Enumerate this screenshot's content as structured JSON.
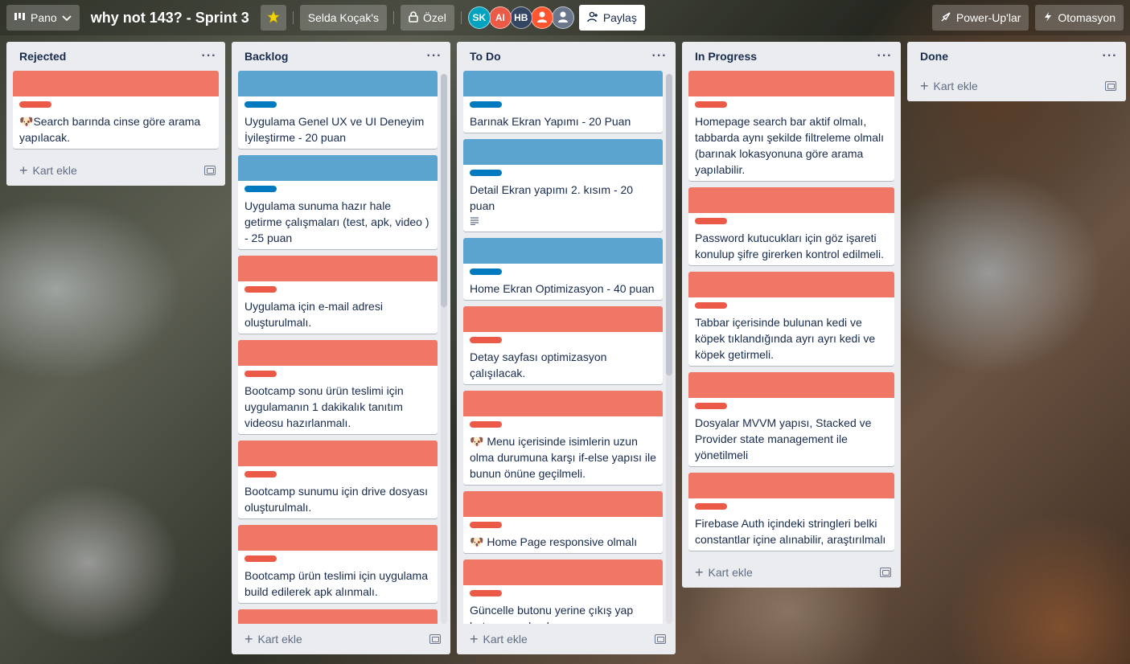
{
  "colors": {
    "red_label": "#eb5a46",
    "red_cover": "#f07766",
    "blue_label": "#0079bf",
    "blue_cover": "#5ba4cf"
  },
  "topbar": {
    "view_icon": "board-icon",
    "view_label": "Pano",
    "board_title": "why not 143? - Sprint 3",
    "workspace": "Selda Koçak's",
    "visibility": "Özel",
    "avatars": [
      {
        "initials": "SK",
        "color": "#00a3bf"
      },
      {
        "initials": "AI",
        "color": "#eb5a46"
      },
      {
        "initials": "HB",
        "color": "#344563"
      },
      {
        "initials": "",
        "color": "#ff5630"
      },
      {
        "initials": "",
        "color": "#6b778c"
      }
    ],
    "share_label": "Paylaş",
    "powerups_label": "Power-Up'lar",
    "automation_label": "Otomasyon"
  },
  "lists": [
    {
      "title": "Rejected",
      "add_card": "Kart ekle",
      "cards": [
        {
          "cover": "red",
          "label": "red",
          "emoji": "🐶",
          "title": "Search barında cinse göre arama yapılacak."
        }
      ]
    },
    {
      "title": "Backlog",
      "add_card": "Kart ekle",
      "cards": [
        {
          "cover": "blue",
          "label": "blue",
          "title": "Uygulama Genel UX ve UI Deneyim İyileştirme - 20 puan"
        },
        {
          "cover": "blue",
          "label": "blue",
          "title": "Uygulama sunuma hazır hale getirme çalışmaları (test, apk, video ) - 25 puan"
        },
        {
          "cover": "red",
          "label": "red",
          "title": "Uygulama için e-mail adresi oluşturulmalı."
        },
        {
          "cover": "red",
          "label": "red",
          "title": "Bootcamp sonu ürün teslimi için uygulamanın 1 dakikalık tanıtım videosu hazırlanmalı."
        },
        {
          "cover": "red",
          "label": "red",
          "title": "Bootcamp sunumu için drive dosyası oluşturulmalı."
        },
        {
          "cover": "red",
          "label": "red",
          "title": "Bootcamp ürün teslimi için uygulama build edilerek apk alınmalı."
        },
        {
          "cover": "red",
          "label": "red",
          "title": ""
        }
      ]
    },
    {
      "title": "To Do",
      "add_card": "Kart ekle",
      "cards": [
        {
          "cover": "blue",
          "label": "blue",
          "title": "Barınak Ekran Yapımı - 20 Puan"
        },
        {
          "cover": "blue",
          "label": "blue",
          "title": "Detail Ekran yapımı 2. kısım - 20 puan",
          "has_description": true
        },
        {
          "cover": "blue",
          "label": "blue",
          "title": "Home Ekran Optimizasyon - 40 puan"
        },
        {
          "cover": "red",
          "label": "red",
          "title": "Detay sayfası optimizasyon çalışılacak."
        },
        {
          "cover": "red",
          "label": "red",
          "emoji": "🐶",
          "title": " Menu içerisinde isimlerin uzun olma durumuna karşı if-else yapısı ile bunun önüne geçilmeli."
        },
        {
          "cover": "red",
          "label": "red",
          "emoji": "🐶",
          "title": " Home Page responsive olmalı"
        },
        {
          "cover": "red",
          "label": "red",
          "title": "Güncelle butonu yerine çıkış yap butonu yapılmalı"
        }
      ]
    },
    {
      "title": "In Progress",
      "add_card": "Kart ekle",
      "cards": [
        {
          "cover": "red",
          "label": "red",
          "title": "Homepage search bar aktif olmalı, tabbarda aynı şekilde filtreleme olmalı (barınak lokasyonuna göre arama yapılabilir."
        },
        {
          "cover": "red",
          "label": "red",
          "title": "Password kutucukları için göz işareti konulup şifre girerken kontrol edilmeli."
        },
        {
          "cover": "red",
          "label": "red",
          "title": "Tabbar içerisinde bulunan kedi ve köpek tıklandığında ayrı ayrı kedi ve köpek getirmeli."
        },
        {
          "cover": "red",
          "label": "red",
          "title": "Dosyalar MVVM yapısı, Stacked ve Provider state management ile yönetilmeli"
        },
        {
          "cover": "red",
          "label": "red",
          "title": "Firebase Auth içindeki stringleri belki constantlar içine alınabilir, araştırılmalı"
        }
      ]
    },
    {
      "title": "Done",
      "add_card": "Kart ekle",
      "cards": []
    }
  ],
  "icons": {
    "list_menu": "more-horizontal-icon",
    "add": "plus-icon",
    "template": "card-template-icon",
    "star": "star-icon",
    "lock": "lock-icon",
    "share": "add-member-icon",
    "powerups": "rocket-icon",
    "automation": "lightning-icon",
    "description": "description-icon"
  }
}
